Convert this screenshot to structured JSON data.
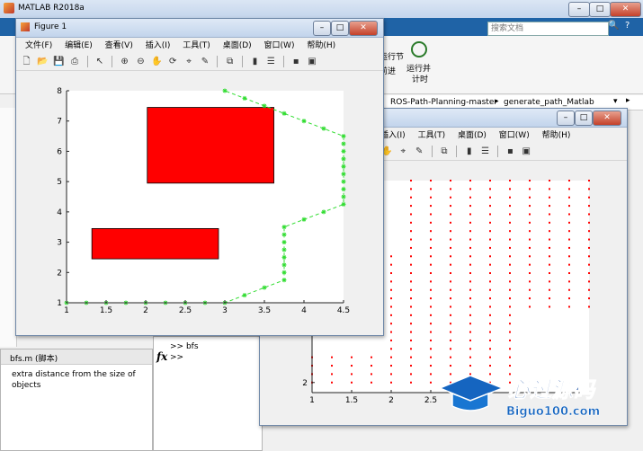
{
  "app": {
    "title": "MATLAB R2018a"
  },
  "search": {
    "placeholder": "搜索文档"
  },
  "ribbon": {
    "items": [
      "运行节",
      "前进",
      "运行并",
      "计时"
    ]
  },
  "breadcrumb": {
    "items": [
      "ROS-Path-Planning-master",
      "generate_path_Matlab"
    ]
  },
  "figure1": {
    "title": "Figure 1",
    "menu": [
      "文件(F)",
      "编辑(E)",
      "查看(V)",
      "插入(I)",
      "工具(T)",
      "桌面(D)",
      "窗口(W)",
      "帮助(H)"
    ]
  },
  "figure2": {
    "menu": [
      "插入(I)",
      "工具(T)",
      "桌面(D)",
      "窗口(W)",
      "帮助(H)"
    ]
  },
  "details": {
    "file": "bfs.m  (脚本)",
    "text": "extra distance from the size of objects"
  },
  "command_window": {
    "history": ">> bfs",
    "prompt": ">>",
    "fx": "fx"
  },
  "watermark": {
    "brand": "必过源码",
    "url": "Biguo100.com"
  },
  "chart_data": [
    {
      "type": "scatter",
      "title": "",
      "xlabel": "",
      "ylabel": "",
      "xlim": [
        1,
        4.5
      ],
      "ylim": [
        1,
        8
      ],
      "xticks": [
        1,
        1.5,
        2,
        2.5,
        3,
        3.5,
        4,
        4.5
      ],
      "yticks": [
        1,
        2,
        3,
        4,
        5,
        6,
        7,
        8
      ],
      "grid": false,
      "obstacles": [
        {
          "x": [
            2.02,
            3.62
          ],
          "y": [
            4.95,
            7.45
          ],
          "color": "#ff0000"
        },
        {
          "x": [
            1.32,
            2.92
          ],
          "y": [
            2.45,
            3.45
          ],
          "color": "#ff0000"
        }
      ],
      "path_color": "#33dd33",
      "path": [
        [
          1.0,
          1.0
        ],
        [
          1.25,
          1.0
        ],
        [
          1.5,
          1.0
        ],
        [
          1.75,
          1.0
        ],
        [
          2.0,
          1.0
        ],
        [
          2.25,
          1.0
        ],
        [
          2.5,
          1.0
        ],
        [
          2.75,
          1.0
        ],
        [
          3.0,
          1.0
        ],
        [
          3.25,
          1.25
        ],
        [
          3.5,
          1.5
        ],
        [
          3.75,
          1.75
        ],
        [
          3.75,
          2.0
        ],
        [
          3.75,
          2.25
        ],
        [
          3.75,
          2.5
        ],
        [
          3.75,
          2.75
        ],
        [
          3.75,
          3.0
        ],
        [
          3.75,
          3.25
        ],
        [
          3.75,
          3.5
        ],
        [
          4.0,
          3.75
        ],
        [
          4.25,
          4.0
        ],
        [
          4.5,
          4.25
        ],
        [
          4.5,
          4.5
        ],
        [
          4.5,
          4.75
        ],
        [
          4.5,
          5.0
        ],
        [
          4.5,
          5.25
        ],
        [
          4.5,
          5.5
        ],
        [
          4.5,
          5.75
        ],
        [
          4.5,
          6.0
        ],
        [
          4.5,
          6.25
        ],
        [
          4.5,
          6.5
        ],
        [
          4.25,
          6.75
        ],
        [
          4.0,
          7.0
        ],
        [
          3.75,
          7.25
        ],
        [
          3.5,
          7.5
        ],
        [
          3.25,
          7.75
        ],
        [
          3.0,
          8.0
        ]
      ]
    },
    {
      "type": "scatter",
      "title": "",
      "xlabel": "",
      "ylabel": "",
      "xlim": [
        1,
        4.5
      ],
      "ylim": [
        1.7,
        8
      ],
      "xticks": [
        1,
        1.5,
        2,
        2.5
      ],
      "yticks": [
        2
      ],
      "grid": false,
      "point_color": "#ff0000",
      "columns": [
        {
          "x": 1.0,
          "ymin": 2.0,
          "ymax": 2.75
        },
        {
          "x": 1.25,
          "ymin": 2.0,
          "ymax": 2.75
        },
        {
          "x": 1.5,
          "ymin": 2.0,
          "ymax": 2.75
        },
        {
          "x": 1.75,
          "ymin": 2.0,
          "ymax": 2.75
        },
        {
          "x": 2.0,
          "ymin": 2.0,
          "ymax": 5.75
        },
        {
          "x": 2.25,
          "ymin": 2.0,
          "ymax": 8.0
        },
        {
          "x": 2.5,
          "ymin": 2.0,
          "ymax": 8.0
        },
        {
          "x": 2.75,
          "ymin": 2.0,
          "ymax": 8.0
        },
        {
          "x": 3.0,
          "ymin": 2.0,
          "ymax": 8.0
        },
        {
          "x": 3.25,
          "ymin": 2.0,
          "ymax": 8.0
        },
        {
          "x": 3.5,
          "ymin": 2.0,
          "ymax": 8.0
        },
        {
          "x": 3.75,
          "ymin": 4.25,
          "ymax": 8.0
        },
        {
          "x": 4.0,
          "ymin": 4.25,
          "ymax": 8.0
        },
        {
          "x": 4.25,
          "ymin": 4.25,
          "ymax": 8.0
        },
        {
          "x": 4.5,
          "ymin": 4.25,
          "ymax": 8.0
        }
      ]
    }
  ]
}
